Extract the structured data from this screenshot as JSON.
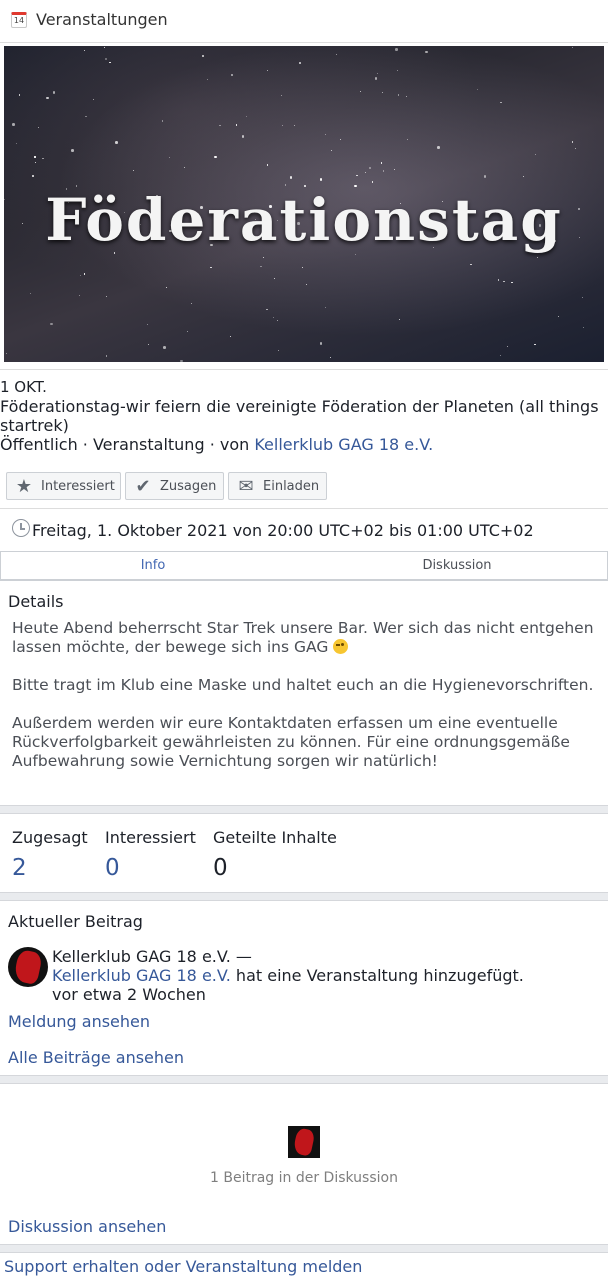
{
  "header": {
    "icon_text": "14",
    "title": "Veranstaltungen"
  },
  "banner": {
    "title": "Föderationstag"
  },
  "event": {
    "date": "1 OKT.",
    "name": "Föderationstag-wir feiern die vereinigte Föderation der Planeten (all things startrek)",
    "meta_prefix": "Öffentlich · Veranstaltung · von ",
    "host": "Kellerklub GAG 18 e.V."
  },
  "actions": {
    "interested": "Interessiert",
    "going": "Zusagen",
    "invite": "Einladen"
  },
  "time": "Freitag, 1. Oktober 2021 von 20:00 UTC+02 bis 01:00 UTC+02",
  "tabs": {
    "info": "Info",
    "discussion": "Diskussion"
  },
  "details": {
    "heading": "Details",
    "p1": "Heute Abend beherrscht Star Trek unsere Bar. Wer sich das nicht entgehen lassen möchte, der bewege sich ins GAG ",
    "p2": "Bitte tragt im Klub eine Maske und haltet euch an die Hygienevorschriften.",
    "p3": "Außerdem werden wir eure Kontaktdaten erfassen um eine eventuelle Rückverfolgbarkeit gewährleisten zu können. Für eine ordnungsgemäße Aufbewahrung sowie Vernichtung sorgen wir natürlich!"
  },
  "stats": [
    {
      "label": "Zugesagt",
      "value": "2"
    },
    {
      "label": "Interessiert",
      "value": "0"
    },
    {
      "label": "Geteilte Inhalte",
      "value": "0"
    }
  ],
  "post": {
    "heading": "Aktueller Beitrag",
    "author": "Kellerklub GAG 18 e.V. —",
    "link_name": "Kellerklub GAG 18 e.V.",
    "action": " hat eine Veranstaltung hinzugefügt.",
    "time": "vor etwa 2 Wochen",
    "view_post": "Meldung ansehen",
    "view_all": "Alle Beiträge ansehen"
  },
  "discussion": {
    "count_text": "1 Beitrag in der Diskussion",
    "view": "Diskussion ansehen"
  },
  "footer": {
    "support": "Support erhalten oder Veranstaltung melden"
  }
}
